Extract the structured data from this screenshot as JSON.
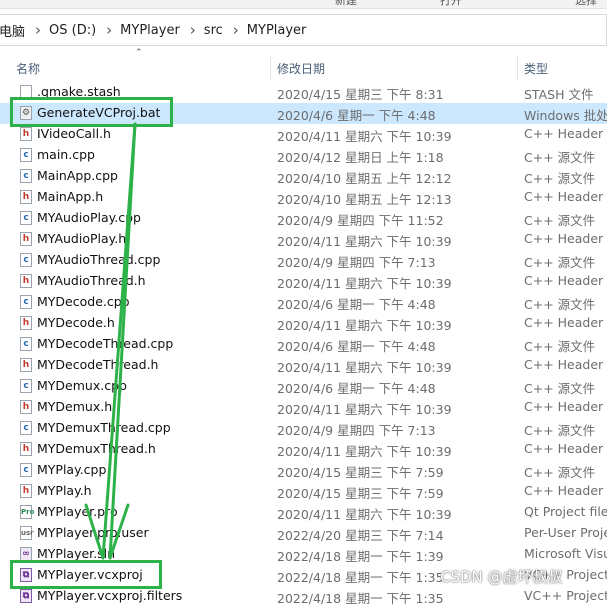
{
  "ribbon": {
    "labels": [
      "新建",
      "打开",
      "选择"
    ]
  },
  "breadcrumb": [
    "电脑",
    "OS (D:)",
    "MYPlayer",
    "src",
    "MYPlayer"
  ],
  "columns": {
    "name": "名称",
    "date": "修改日期",
    "type": "类型"
  },
  "rows": [
    {
      "name": ".qmake.stash",
      "date": "2020/4/15 星期三 下午 8:31",
      "type": "STASH 文件",
      "icon": "plain"
    },
    {
      "name": "GenerateVCProj.bat",
      "date": "2020/4/6 星期一 下午 4:48",
      "type": "Windows 批处理",
      "icon": "bat",
      "selected": true,
      "highlighted": true
    },
    {
      "name": "IVideoCall.h",
      "date": "2020/4/11 星期六 下午 10:39",
      "type": "C++ Header file",
      "icon": "h"
    },
    {
      "name": "main.cpp",
      "date": "2020/4/12 星期日 上午 1:18",
      "type": "C++ 源文件",
      "icon": "cpp"
    },
    {
      "name": "MainApp.cpp",
      "date": "2020/4/10 星期五 上午 12:12",
      "type": "C++ 源文件",
      "icon": "cpp"
    },
    {
      "name": "MainApp.h",
      "date": "2020/4/10 星期五 上午 12:13",
      "type": "C++ Header file",
      "icon": "h"
    },
    {
      "name": "MYAudioPlay.cpp",
      "date": "2020/4/9 星期四 下午 11:52",
      "type": "C++ 源文件",
      "icon": "cpp"
    },
    {
      "name": "MYAudioPlay.h",
      "date": "2020/4/11 星期六 下午 10:39",
      "type": "C++ Header file",
      "icon": "h"
    },
    {
      "name": "MYAudioThread.cpp",
      "date": "2020/4/9 星期四 下午 7:13",
      "type": "C++ 源文件",
      "icon": "cpp"
    },
    {
      "name": "MYAudioThread.h",
      "date": "2020/4/11 星期六 下午 10:39",
      "type": "C++ Header file",
      "icon": "h"
    },
    {
      "name": "MYDecode.cpp",
      "date": "2020/4/6 星期一 下午 4:48",
      "type": "C++ 源文件",
      "icon": "cpp"
    },
    {
      "name": "MYDecode.h",
      "date": "2020/4/11 星期六 下午 10:39",
      "type": "C++ Header file",
      "icon": "h"
    },
    {
      "name": "MYDecodeThread.cpp",
      "date": "2020/4/6 星期一 下午 4:48",
      "type": "C++ 源文件",
      "icon": "cpp"
    },
    {
      "name": "MYDecodeThread.h",
      "date": "2020/4/11 星期六 下午 10:39",
      "type": "C++ Header file",
      "icon": "h"
    },
    {
      "name": "MYDemux.cpp",
      "date": "2020/4/6 星期一 下午 4:48",
      "type": "C++ 源文件",
      "icon": "cpp"
    },
    {
      "name": "MYDemux.h",
      "date": "2020/4/11 星期六 下午 10:39",
      "type": "C++ Header file",
      "icon": "h"
    },
    {
      "name": "MYDemuxThread.cpp",
      "date": "2020/4/9 星期四 下午 7:13",
      "type": "C++ 源文件",
      "icon": "cpp"
    },
    {
      "name": "MYDemuxThread.h",
      "date": "2020/4/11 星期六 下午 10:39",
      "type": "C++ Header file",
      "icon": "h"
    },
    {
      "name": "MYPlay.cpp",
      "date": "2020/4/15 星期三 下午 7:59",
      "type": "C++ 源文件",
      "icon": "cpp"
    },
    {
      "name": "MYPlay.h",
      "date": "2020/4/15 星期三 下午 7:59",
      "type": "C++ Header file",
      "icon": "h"
    },
    {
      "name": "MYPlayer.pro",
      "date": "2020/4/11 星期六 下午 10:39",
      "type": "Qt Project file",
      "icon": "pro"
    },
    {
      "name": "MYPlayer.pro.user",
      "date": "2022/4/20 星期三 下午 7:14",
      "type": "Per-User Project",
      "icon": "user"
    },
    {
      "name": "MYPlayer.sln",
      "date": "2022/4/18 星期一 下午 1:39",
      "type": "Microsoft Visual",
      "icon": "sln"
    },
    {
      "name": "MYPlayer.vcxproj",
      "date": "2022/4/18 星期一 下午 1:35",
      "type": "VC++ Project",
      "icon": "vcx",
      "highlighted": true
    },
    {
      "name": "MYPlayer.vcxproj.filters",
      "date": "2022/4/18 星期一 下午 1:35",
      "type": "VC++ Project",
      "icon": "vcx"
    }
  ],
  "watermark": "CSDN @虚坏叔叔",
  "colors": {
    "selection": "#cce8ff",
    "annotation_green": "#2db24a"
  },
  "icons": {
    "h": "c-header-file-icon",
    "cpp": "cpp-source-file-icon",
    "bat": "batch-file-icon",
    "pro": "qt-project-icon",
    "user": "user-file-icon",
    "sln": "visual-studio-solution-icon",
    "vcx": "vcxproj-file-icon",
    "plain": "generic-file-icon"
  }
}
